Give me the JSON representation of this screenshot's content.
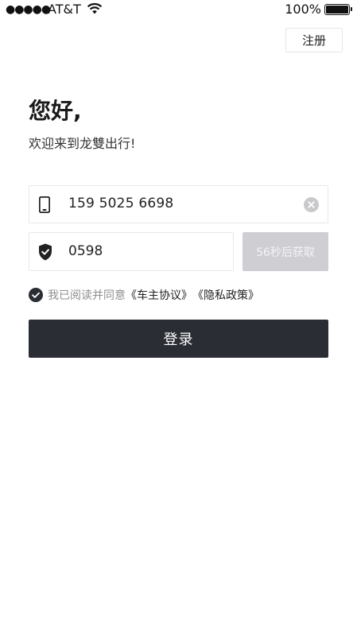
{
  "status_bar": {
    "signal": "●●●●●",
    "carrier": "AT&T",
    "battery_percent": "100%",
    "battery_level": 1.0
  },
  "header": {
    "register_label": "注册"
  },
  "intro": {
    "greeting": "您好,",
    "welcome": "欢迎来到龙雙出行!"
  },
  "form": {
    "phone_value": "159 5025 6698",
    "code_value": "0598",
    "get_code_label": "56秒后获取"
  },
  "agreement": {
    "prefix": "我已阅读并同意",
    "link_driver": "《车主协议》",
    "link_privacy": "《隐私政策》",
    "checked": true
  },
  "actions": {
    "login_label": "登录"
  },
  "colors": {
    "primary_button": "#2b2d35",
    "disabled_button": "#cfced3",
    "field_border": "#e8e8e8"
  },
  "icons": {
    "phone": "phone-icon",
    "clear": "clear-icon",
    "shield": "shield-check-icon",
    "check": "check-circle-icon",
    "wifi": "wifi-icon",
    "battery": "battery-icon"
  }
}
